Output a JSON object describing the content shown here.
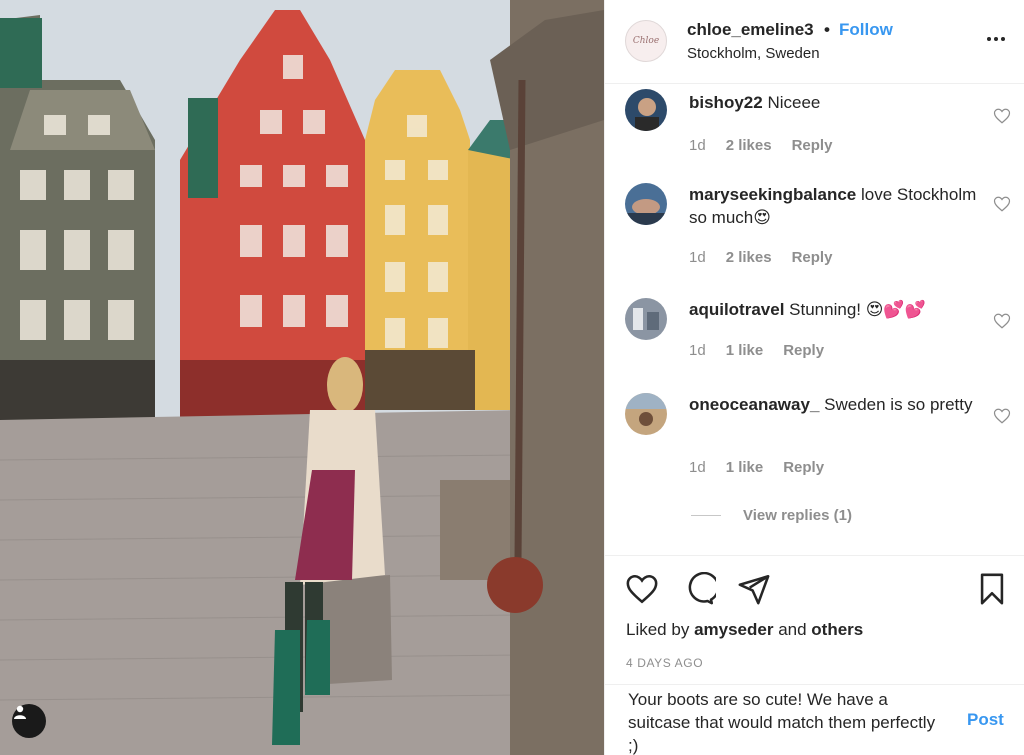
{
  "post": {
    "username": "chloe_emeline3",
    "separator": "•",
    "follow_label": "Follow",
    "location": "Stockholm, Sweden",
    "avatar_text": "Chloe"
  },
  "comments": [
    {
      "user": "bishoy22",
      "text": "Niceee",
      "time": "1d",
      "likes": "2 likes",
      "reply": "Reply"
    },
    {
      "user": "maryseekingbalance",
      "text": "love Stockholm so much😍",
      "time": "1d",
      "likes": "2 likes",
      "reply": "Reply"
    },
    {
      "user": "aquilotravel",
      "text": "Stunning! 😍💕💕",
      "time": "1d",
      "likes": "1 like",
      "reply": "Reply"
    },
    {
      "user": "oneoceanaway_",
      "text": "Sweden is so pretty",
      "time": "1d",
      "likes": "1 like",
      "reply": "Reply"
    }
  ],
  "view_replies": "View replies (1)",
  "actions": {
    "icons": [
      "heart-icon",
      "comment-icon",
      "share-icon",
      "bookmark-icon"
    ]
  },
  "liked_by": {
    "prefix": "Liked by",
    "user": "amyseder",
    "and": "and",
    "others": "others"
  },
  "timestamp": "4 DAYS AGO",
  "composer": {
    "text": "Your boots are so cute! We have a suitcase that would match them perfectly ;)",
    "post_label": "Post"
  },
  "colors": {
    "link_blue": "#3897f0",
    "muted": "#8e8e8e",
    "text": "#262626"
  }
}
